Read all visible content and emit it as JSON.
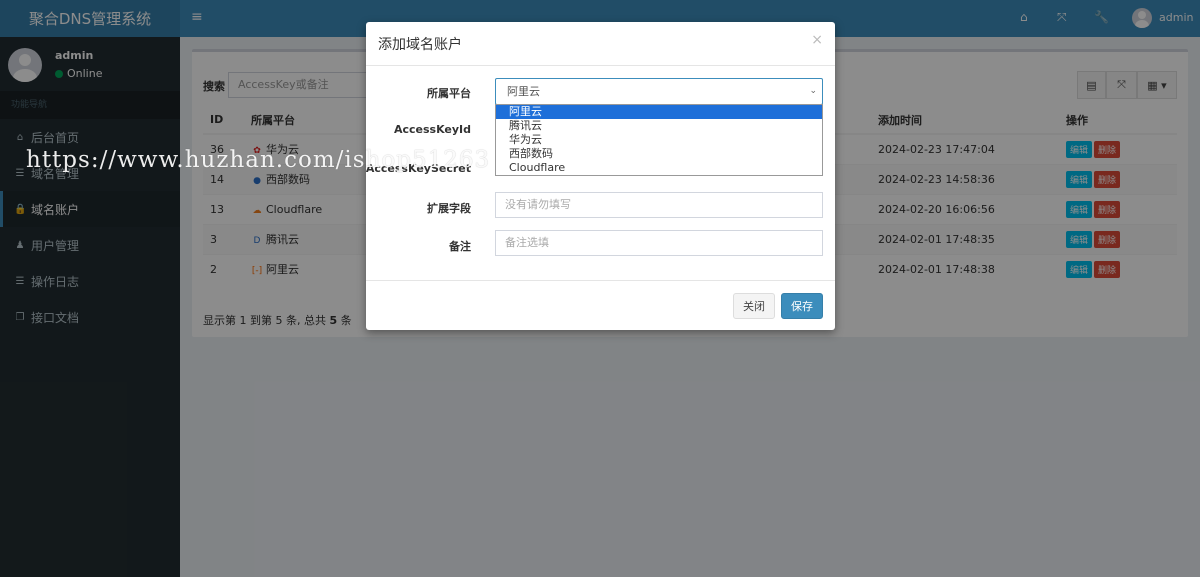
{
  "brand": "聚合DNS管理系统",
  "user": {
    "name": "admin",
    "status": "Online"
  },
  "sidebar": {
    "header": "功能导航",
    "items": [
      {
        "label": "后台首页",
        "icon": "home-icon",
        "glyph": "⌂"
      },
      {
        "label": "域名管理",
        "icon": "list-icon",
        "glyph": "☰"
      },
      {
        "label": "域名账户",
        "icon": "lock-icon",
        "glyph": "🔒"
      },
      {
        "label": "用户管理",
        "icon": "user-icon",
        "glyph": "♟"
      },
      {
        "label": "操作日志",
        "icon": "list-icon",
        "glyph": "☰"
      },
      {
        "label": "接口文档",
        "icon": "book-icon",
        "glyph": "❐"
      }
    ]
  },
  "topbar": {
    "username": "admin"
  },
  "toolbar": {
    "search_label": "搜索",
    "search_placeholder": "AccessKey或备注"
  },
  "table": {
    "headers": {
      "id": "ID",
      "platform": "所属平台",
      "time": "添加时间",
      "ops": "操作"
    },
    "rows": [
      {
        "id": "36",
        "platform": "华为云",
        "time": "2024-02-23 17:47:04",
        "color": "#e02020",
        "glyph": "✿"
      },
      {
        "id": "14",
        "platform": "西部数码",
        "time": "2024-02-23 14:58:36",
        "color": "#2a6fc9",
        "glyph": "●"
      },
      {
        "id": "13",
        "platform": "Cloudflare",
        "time": "2024-02-20 16:06:56",
        "color": "#f38020",
        "glyph": "☁"
      },
      {
        "id": "3",
        "platform": "腾讯云",
        "time": "2024-02-01 17:48:35",
        "color": "#2a6fc9",
        "glyph": "D"
      },
      {
        "id": "2",
        "platform": "阿里云",
        "time": "2024-02-01 17:48:38",
        "color": "#ff6a00",
        "glyph": "[-]"
      }
    ],
    "edit_label": "编辑",
    "delete_label": "删除"
  },
  "pager": {
    "prefix": "显示第 1 到第 5 条, 总共 ",
    "total": "5",
    "suffix": " 条"
  },
  "modal": {
    "title": "添加域名账户",
    "fields": {
      "platform_label": "所属平台",
      "platform_value": "阿里云",
      "accesskeyid_label": "AccessKeyId",
      "accesskeysecret_label": "AccessKeySecret",
      "ext_label": "扩展字段",
      "ext_placeholder": "没有请勿填写",
      "remark_label": "备注",
      "remark_placeholder": "备注选填"
    },
    "dropdown_options": [
      "阿里云",
      "腾讯云",
      "华为云",
      "西部数码",
      "Cloudflare"
    ],
    "close_label": "关闭",
    "save_label": "保存"
  },
  "watermark": "https://www.huzhan.com/ishop51263"
}
